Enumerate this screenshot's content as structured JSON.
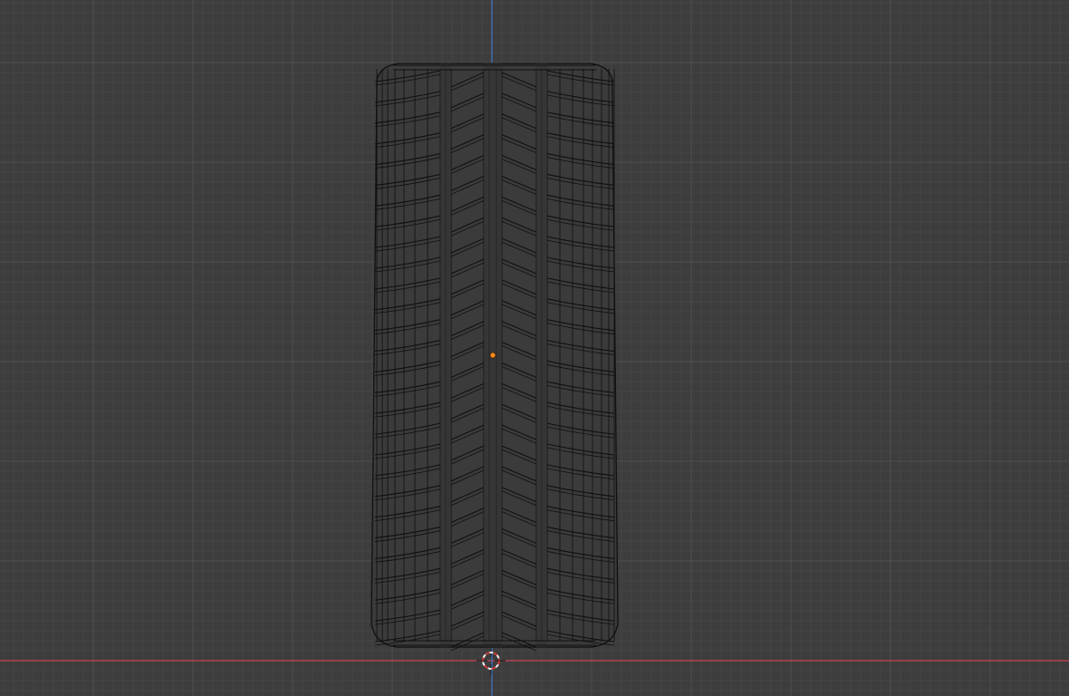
{
  "app": {
    "view": "3d-viewport",
    "mode": "wireframe-edit",
    "object": "tire-mesh"
  },
  "colors": {
    "background": "#3d3d3d",
    "grid_minor": "#454545",
    "grid_major": "#505050",
    "x_axis": "#c84352",
    "z_axis": "#3f79c4",
    "mesh_fill": "#3b3b3b",
    "mesh_wire": "#101010",
    "origin_dot": "#ff8c1a",
    "cursor_red": "#d23b3b",
    "cursor_white": "#f2f2f2"
  },
  "icons": {
    "origin": "object-origin-icon",
    "cursor": "3d-cursor-icon"
  }
}
